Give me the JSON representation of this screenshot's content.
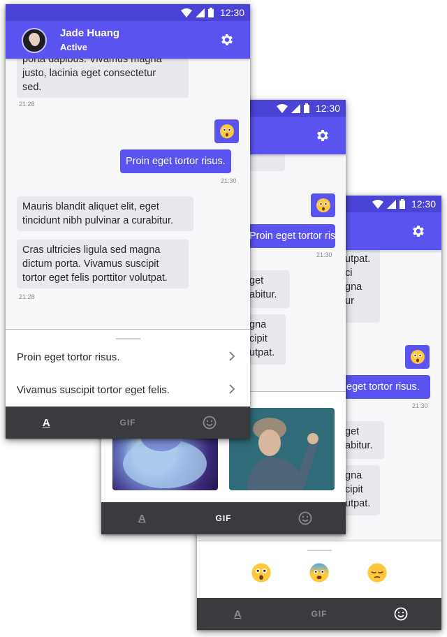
{
  "status": {
    "time": "12:30"
  },
  "contact": {
    "name": "Jade Huang",
    "status": "Active"
  },
  "messages": {
    "partial_in": "porta dapibus. Vivamus magna justo, lacinia eget consectetur sed.",
    "partial_in_line1": "porta dapibus. Vivamus magna",
    "partial_in_line2": "justo, lacinia eget consectetur",
    "partial_in_line3": "sed.",
    "ts1": "21:28",
    "out_text": "Proin eget tortor risus.",
    "ts2": "21:30",
    "in_1": "Mauris blandit aliquet elit, eget tincidunt nibh pulvinar a curabitur.",
    "in_2": "Cras ultricies ligula sed magna dictum porta. Vivamus suscipit tortor eget felis porttitor volutpat.",
    "ts3": "21:28"
  },
  "phone_b": {
    "frag_1a": "get",
    "frag_1b": "abitur.",
    "frag_2a": "gna",
    "frag_2b": "cipit",
    "frag_2c": "utpat."
  },
  "phone_c": {
    "frag_top_a": "utpat.",
    "frag_top_b": "ci",
    "frag_top_c": "gna",
    "frag_top_d": "ur",
    "frag_out": "eget tortor risus.",
    "frag_1a": "get",
    "frag_1b": "abitur.",
    "frag_2a": "gna",
    "frag_2b": "cipit",
    "frag_2c": "utpat."
  },
  "suggestions": [
    {
      "label": "Proin eget tortor risus."
    },
    {
      "label": "Vivamus suscipit tortor eget felis."
    }
  ],
  "tabs": {
    "text_glyph": "A",
    "gif": "GIF"
  },
  "emojis": [
    "astonished-face",
    "anxious-face-with-sweat",
    "pensive-face"
  ],
  "colors": {
    "primary": "#5b53f0",
    "status_bar": "#4b43d6",
    "bottom_bar": "#3a3b3e",
    "bubble_in": "#e7e9ee"
  }
}
